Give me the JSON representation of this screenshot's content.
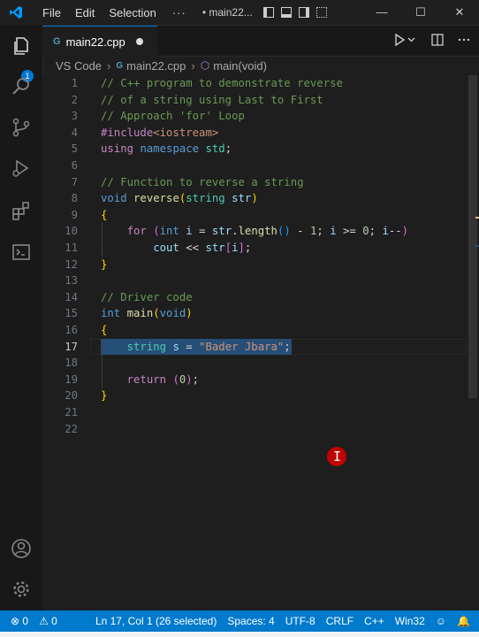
{
  "menu": {
    "file": "File",
    "edit": "Edit",
    "selection": "Selection",
    "more": "···"
  },
  "window_title": "• main22...",
  "window_controls": {
    "minimize": "—",
    "maximize": "☐",
    "close": "✕"
  },
  "activity": {
    "explorer_badge": "1"
  },
  "tab": {
    "icon_text": "G",
    "filename": "main22.cpp"
  },
  "breadcrumb": {
    "root": "VS Code",
    "file": "main22.cpp",
    "symbol": "main(void)",
    "file_icon": "G",
    "symbol_icon": "⬡"
  },
  "editor": {
    "current_line": 17,
    "lines": [
      [
        [
          "cmt",
          "// C++ program to demonstrate reverse"
        ]
      ],
      [
        [
          "cmt",
          "// of a string using Last to First"
        ]
      ],
      [
        [
          "cmt",
          "// Approach 'for' Loop"
        ]
      ],
      [
        [
          "pp",
          "#include"
        ],
        [
          "str",
          "<iostream>"
        ]
      ],
      [
        [
          "pp",
          "using"
        ],
        [
          "plain",
          " "
        ],
        [
          "kw",
          "namespace"
        ],
        [
          "plain",
          " "
        ],
        [
          "ty",
          "std"
        ],
        [
          "plain",
          ";"
        ]
      ],
      [],
      [
        [
          "cmt",
          "// Function to reverse a string"
        ]
      ],
      [
        [
          "kw",
          "void"
        ],
        [
          "plain",
          " "
        ],
        [
          "fn",
          "reverse"
        ],
        [
          "br1",
          "("
        ],
        [
          "ty",
          "string"
        ],
        [
          "plain",
          " "
        ],
        [
          "var",
          "str"
        ],
        [
          "br1",
          ")"
        ]
      ],
      [
        [
          "br1",
          "{"
        ]
      ],
      [
        [
          "plain",
          "    "
        ],
        [
          "pp",
          "for"
        ],
        [
          "plain",
          " "
        ],
        [
          "br2",
          "("
        ],
        [
          "kw",
          "int"
        ],
        [
          "plain",
          " "
        ],
        [
          "var",
          "i"
        ],
        [
          "plain",
          " = "
        ],
        [
          "var",
          "str"
        ],
        [
          "plain",
          "."
        ],
        [
          "fn",
          "length"
        ],
        [
          "br3",
          "()"
        ],
        [
          "plain",
          " - "
        ],
        [
          "num",
          "1"
        ],
        [
          "plain",
          "; "
        ],
        [
          "var",
          "i"
        ],
        [
          "plain",
          " >= "
        ],
        [
          "num",
          "0"
        ],
        [
          "plain",
          "; "
        ],
        [
          "var",
          "i"
        ],
        [
          "plain",
          "--"
        ],
        [
          "br2",
          ")"
        ]
      ],
      [
        [
          "plain",
          "        "
        ],
        [
          "var",
          "cout"
        ],
        [
          "plain",
          " << "
        ],
        [
          "var",
          "str"
        ],
        [
          "br2",
          "["
        ],
        [
          "var",
          "i"
        ],
        [
          "br2",
          "]"
        ],
        [
          "plain",
          ";"
        ]
      ],
      [
        [
          "br1",
          "}"
        ]
      ],
      [],
      [
        [
          "cmt",
          "// Driver code"
        ]
      ],
      [
        [
          "kw",
          "int"
        ],
        [
          "plain",
          " "
        ],
        [
          "fn",
          "main"
        ],
        [
          "br1",
          "("
        ],
        [
          "kw",
          "void"
        ],
        [
          "br1",
          ")"
        ]
      ],
      [
        [
          "br1",
          "{"
        ]
      ],
      [
        [
          "plain",
          "    "
        ],
        [
          "ty",
          "string"
        ],
        [
          "plain",
          " "
        ],
        [
          "var",
          "s"
        ],
        [
          "plain",
          " = "
        ],
        [
          "str",
          "\"Bader Jbara\""
        ],
        [
          "plain",
          ";"
        ]
      ],
      [],
      [
        [
          "plain",
          "    "
        ],
        [
          "pp",
          "return"
        ],
        [
          "plain",
          " "
        ],
        [
          "br2",
          "("
        ],
        [
          "num",
          "0"
        ],
        [
          "br2",
          ")"
        ],
        [
          "plain",
          ";"
        ]
      ],
      [
        [
          "br1",
          "}"
        ]
      ],
      [],
      []
    ]
  },
  "status": {
    "remote": "⇌",
    "errors": "⊗ 0",
    "warnings": "⚠ 0",
    "position": "Ln 17, Col 1 (26 selected)",
    "spaces": "Spaces: 4",
    "encoding": "UTF-8",
    "eol": "CRLF",
    "language": "C++",
    "platform": "Win32",
    "feedback": "☺",
    "bell": "🔔"
  },
  "colors": {
    "accent": "#007acc",
    "selection": "#264f78",
    "cursor_marker": "#d00000"
  }
}
